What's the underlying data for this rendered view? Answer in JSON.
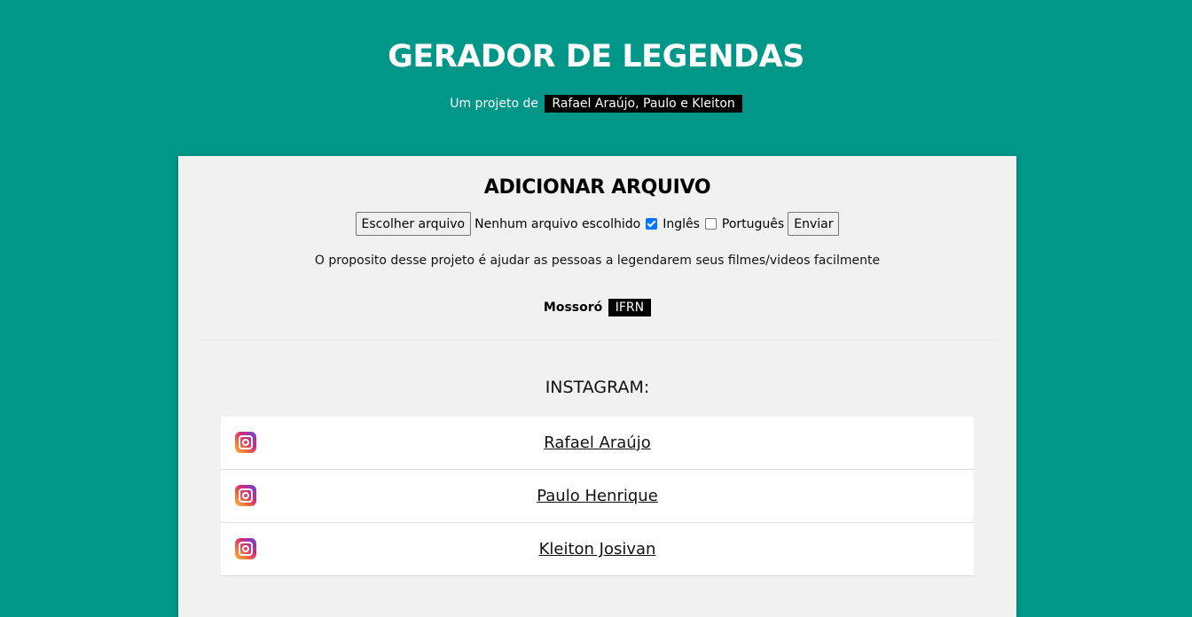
{
  "header": {
    "title": "GERADOR DE LEGENDAS",
    "subtitle_prefix": "Um projeto de",
    "authors": "Rafael Araújo, Paulo e Kleiton"
  },
  "upload": {
    "section_title": "ADICIONAR ARQUIVO",
    "choose_file_label": "Escolher arquivo",
    "no_file_text": "Nenhum arquivo escolhido",
    "english_label": "Inglês",
    "english_checked": true,
    "portuguese_label": "Português",
    "portuguese_checked": false,
    "submit_label": "Enviar"
  },
  "purpose": "O proposito desse projeto é ajudar as pessoas a legendarem seus filmes/videos facilmente",
  "location": {
    "city": "Mossoró",
    "institution": "IFRN"
  },
  "instagram": {
    "title": "INSTAGRAM:",
    "links": [
      {
        "name": "Rafael Araújo",
        "icon": "instagram-icon"
      },
      {
        "name": "Paulo Henrique",
        "icon": "instagram-icon"
      },
      {
        "name": "Kleiton Josivan",
        "icon": "instagram-icon"
      }
    ]
  },
  "colors": {
    "background": "#009688",
    "card": "#f1f1f1",
    "tag": "#000000"
  }
}
